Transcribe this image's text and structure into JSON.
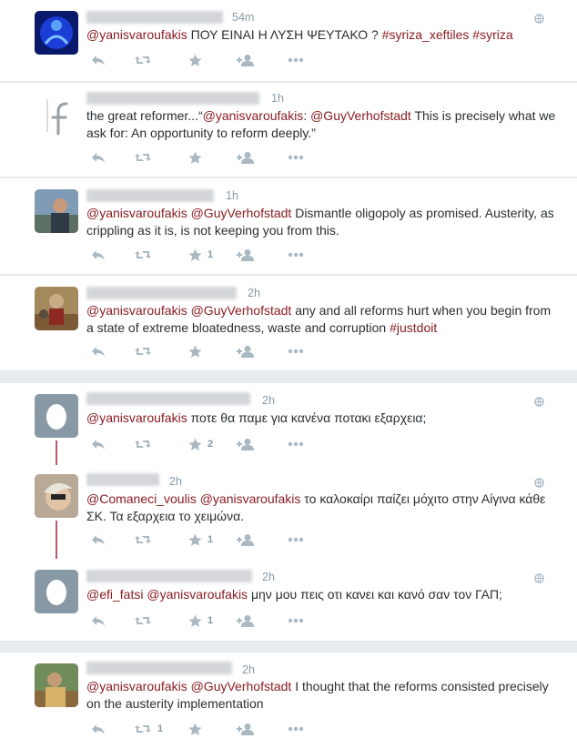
{
  "tweets": [
    {
      "time": "54m",
      "segments": [
        {
          "t": "@yanisvaroufakis",
          "k": "mention"
        },
        {
          "t": " ΠΟΥ ΕΙΝΑΙ Η ΛΥΣΗ ΨΕΥΤΑΚΟ ? ",
          "k": "text"
        },
        {
          "t": "#syriza_xeftiles",
          "k": "hashtag"
        },
        {
          "t": " ",
          "k": "text"
        },
        {
          "t": "#syriza",
          "k": "hashtag"
        }
      ],
      "fav_count": ""
    },
    {
      "time": "1h",
      "segments": [
        {
          "t": "the great reformer...“",
          "k": "text"
        },
        {
          "t": "@yanisvaroufakis",
          "k": "mention"
        },
        {
          "t": ": ",
          "k": "text"
        },
        {
          "t": "@GuyVerhofstadt",
          "k": "mention"
        },
        {
          "t": " This is precisely what we ask for: An opportunity to reform deeply.”",
          "k": "text"
        }
      ],
      "fav_count": ""
    },
    {
      "time": "1h",
      "segments": [
        {
          "t": "@yanisvaroufakis",
          "k": "mention"
        },
        {
          "t": " ",
          "k": "text"
        },
        {
          "t": "@GuyVerhofstadt",
          "k": "mention"
        },
        {
          "t": " Dismantle oligopoly as promised. Austerity, as crippling as it is, is not keeping you from this.",
          "k": "text"
        }
      ],
      "fav_count": "1"
    },
    {
      "time": "2h",
      "segments": [
        {
          "t": "@yanisvaroufakis",
          "k": "mention"
        },
        {
          "t": " ",
          "k": "text"
        },
        {
          "t": "@GuyVerhofstadt",
          "k": "mention"
        },
        {
          "t": " any and all reforms hurt when you begin from a state of extreme bloatedness, waste and corruption ",
          "k": "text"
        },
        {
          "t": "#justdoit",
          "k": "hashtag"
        }
      ],
      "fav_count": ""
    },
    {
      "time": "2h",
      "segments": [
        {
          "t": "@yanisvaroufakis",
          "k": "mention"
        },
        {
          "t": " ποτε θα παμε για κανένα ποτακι εξαρχεια;",
          "k": "text"
        }
      ],
      "fav_count": "2"
    },
    {
      "time": "2h",
      "segments": [
        {
          "t": "@Comaneci_voulis",
          "k": "mention"
        },
        {
          "t": " ",
          "k": "text"
        },
        {
          "t": "@yanisvaroufakis",
          "k": "mention"
        },
        {
          "t": " το καλοκαίρι παίζει μόχιτο στην Αίγινα κάθε ΣΚ. Τα εξαρχεια το χειμώνα.",
          "k": "text"
        }
      ],
      "fav_count": "1"
    },
    {
      "time": "2h",
      "segments": [
        {
          "t": "@efi_fatsi",
          "k": "mention"
        },
        {
          "t": " ",
          "k": "text"
        },
        {
          "t": "@yanisvaroufakis",
          "k": "mention"
        },
        {
          "t": " μην μου πεις οτι κανει και κανό σαν τον ΓΑΠ;",
          "k": "text"
        }
      ],
      "fav_count": "1"
    },
    {
      "time": "2h",
      "segments": [
        {
          "t": "@yanisvaroufakis",
          "k": "mention"
        },
        {
          "t": " ",
          "k": "text"
        },
        {
          "t": "@GuyVerhofstadt",
          "k": "mention"
        },
        {
          "t": " I thought that the reforms consisted precisely on the austerity implementation",
          "k": "text"
        }
      ],
      "fav_count": "",
      "retweet_count": "1"
    }
  ],
  "colors": {
    "link": "#8a1d22",
    "text": "#292f33",
    "muted": "#8899a6",
    "icon": "#aab8c2",
    "thread": "#b85c68"
  },
  "icons": [
    "reply-icon",
    "retweet-icon",
    "favorite-icon",
    "follow-icon",
    "more-icon",
    "globe-icon"
  ]
}
